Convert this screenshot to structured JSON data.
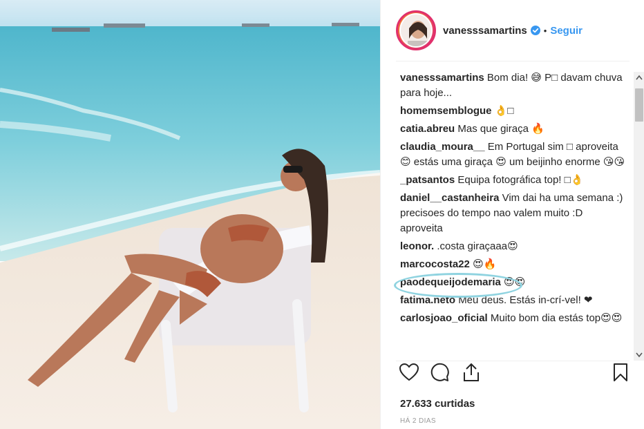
{
  "post": {
    "username": "vanesssamartins",
    "follow_label": "Seguir",
    "dot": "•",
    "likes": "27.633 curtidas",
    "time": "HÁ 2 DIAS"
  },
  "comments": [
    {
      "user": "vanesssamartins",
      "text": "Bom dia! 😅 P□ davam chuva para hoje..."
    },
    {
      "user": "homemsemblogue",
      "text": "👌□"
    },
    {
      "user": "catia.abreu",
      "text": "Mas que giraça 🔥"
    },
    {
      "user": "claudia_moura__",
      "text": "Em Portugal sim □ aproveita 😊 estás uma giraça 😍 um beijinho enorme 😘😘"
    },
    {
      "user": "_patsantos",
      "text": "Equipa fotográfica top! □👌"
    },
    {
      "user": "daniel__castanheira",
      "text": "Vim dai ha uma semana :) precisoes do tempo nao valem muito :D aproveita"
    },
    {
      "user": "leonor.",
      "text": ".costa giraçaaa😍"
    },
    {
      "user": "marcocosta22",
      "text": "😍🔥"
    },
    {
      "user": "paodequeijodemaria",
      "text": "😍😍"
    },
    {
      "user": "fatima.neto",
      "text": "Meu deus. Estás in-crí-vel! ❤"
    },
    {
      "user": "carlosjoao_oficial",
      "text": "Muito bom dia estás top😍😍"
    }
  ],
  "colors": {
    "follow": "#3897f0",
    "verified": "#3897f0",
    "highlight": "#8fd3e0"
  },
  "icons": {
    "like": "heart-icon",
    "comment": "comment-icon",
    "share": "share-icon",
    "save": "bookmark-icon"
  }
}
